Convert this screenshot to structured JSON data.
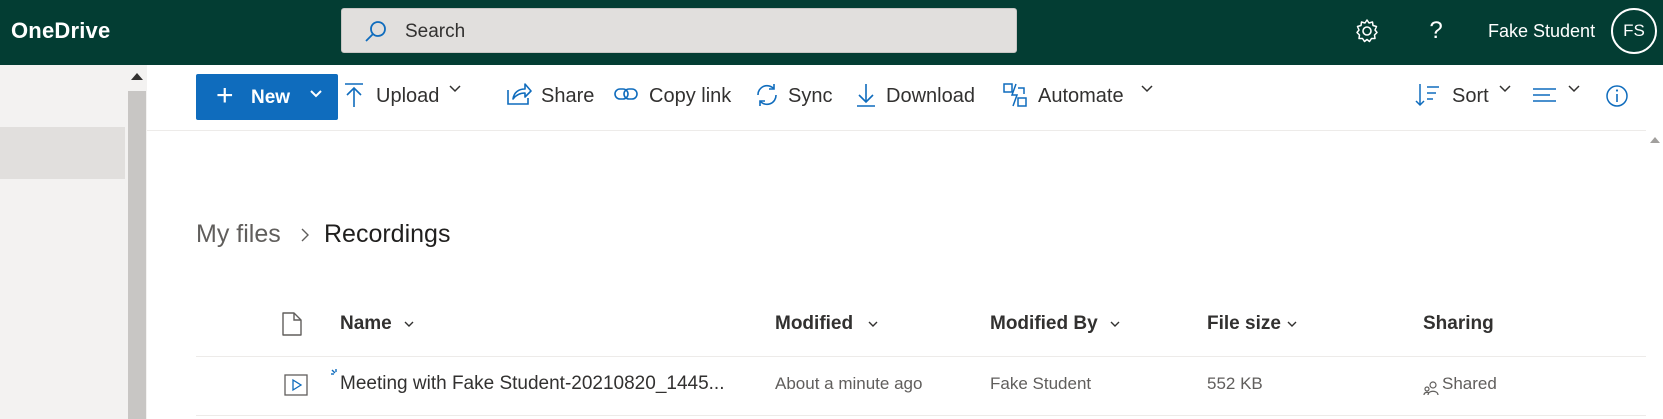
{
  "app": {
    "brand": "OneDrive"
  },
  "search": {
    "placeholder": "Search"
  },
  "header": {
    "user_name": "Fake Student",
    "user_initials": "FS",
    "help_label": "?"
  },
  "toolbar": {
    "new_label": "New",
    "upload_label": "Upload",
    "share_label": "Share",
    "copy_link_label": "Copy link",
    "sync_label": "Sync",
    "download_label": "Download",
    "automate_label": "Automate",
    "sort_label": "Sort"
  },
  "breadcrumb": {
    "parent": "My files",
    "current": "Recordings"
  },
  "table": {
    "columns": {
      "name": "Name",
      "modified": "Modified",
      "modified_by": "Modified By",
      "file_size": "File size",
      "sharing": "Sharing"
    },
    "rows": [
      {
        "name": "Meeting with Fake Student-20210820_1445...",
        "modified": "About a minute ago",
        "modified_by": "Fake Student",
        "file_size": "552 KB",
        "sharing": "Shared"
      }
    ]
  },
  "colors": {
    "topbar": "#033d33",
    "accent": "#0f6cbd",
    "icon_blue": "#0f6cbd"
  },
  "icons": [
    "search-icon",
    "gear-icon",
    "help-icon",
    "plus-icon",
    "upload-icon",
    "share-icon",
    "link-icon",
    "sync-icon",
    "download-icon",
    "automate-icon",
    "sort-icon",
    "view-options-icon",
    "info-icon",
    "file-type-icon",
    "video-file-icon",
    "shared-people-icon"
  ]
}
